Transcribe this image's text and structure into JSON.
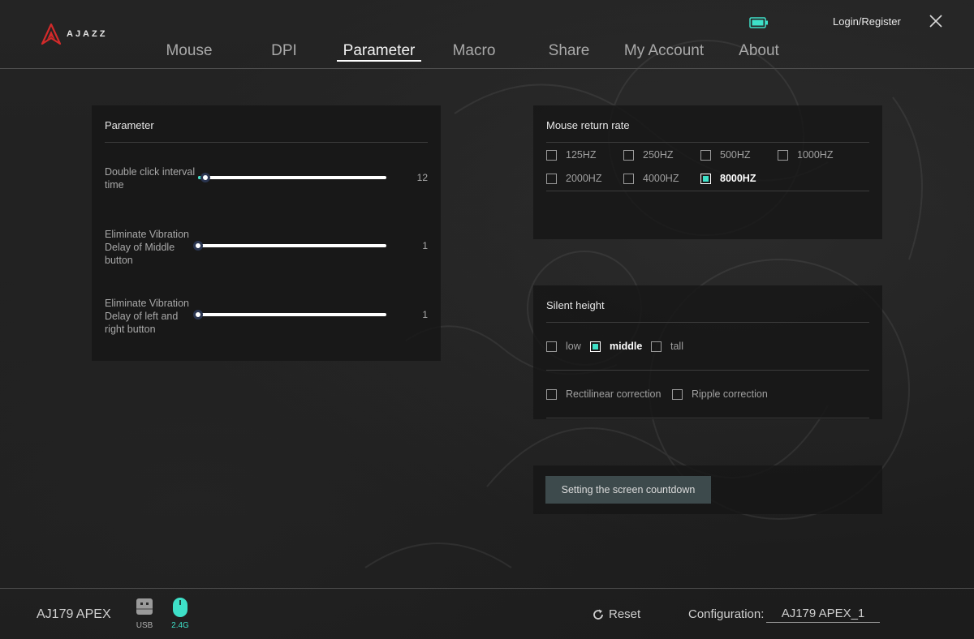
{
  "header": {
    "logo_text": "AJAZZ",
    "login_label": "Login/Register",
    "battery_icon": "battery-icon",
    "close_icon": "close-icon",
    "accent_color": "#3ee0c8"
  },
  "nav": {
    "tabs": [
      {
        "label": "Mouse"
      },
      {
        "label": "DPI"
      },
      {
        "label": "Parameter",
        "active": true
      },
      {
        "label": "Macro"
      },
      {
        "label": "Share"
      },
      {
        "label": "My Account"
      },
      {
        "label": "About"
      }
    ]
  },
  "parameter_panel": {
    "title": "Parameter",
    "sliders": [
      {
        "label": "Double click interval time",
        "value": "12",
        "level": 0.04
      },
      {
        "label": "Eliminate Vibration Delay of Middle button",
        "value": "1",
        "level": 0.0
      },
      {
        "label": "Eliminate Vibration Delay of left and right button",
        "value": "1",
        "level": 0.0
      }
    ]
  },
  "return_rate_panel": {
    "title": "Mouse return rate",
    "options": [
      {
        "label": "125HZ",
        "checked": false
      },
      {
        "label": "250HZ",
        "checked": false
      },
      {
        "label": "500HZ",
        "checked": false
      },
      {
        "label": "1000HZ",
        "checked": false
      },
      {
        "label": "2000HZ",
        "checked": false
      },
      {
        "label": "4000HZ",
        "checked": false
      },
      {
        "label": "8000HZ",
        "checked": true
      }
    ]
  },
  "silent_height_panel": {
    "title": "Silent height",
    "heights": [
      {
        "label": "low",
        "checked": false
      },
      {
        "label": "middle",
        "checked": true
      },
      {
        "label": "tall",
        "checked": false
      }
    ],
    "corrections": [
      {
        "label": "Rectilinear correction",
        "checked": false
      },
      {
        "label": "Ripple correction",
        "checked": false
      }
    ]
  },
  "countdown_button_label": "Setting the screen countdown",
  "footer": {
    "device_name": "AJ179 APEX",
    "usb_label": "USB",
    "wireless_label": "2.4G",
    "reset_label": "Reset",
    "config_label": "Configuration:",
    "config_value": "AJ179 APEX_1"
  }
}
